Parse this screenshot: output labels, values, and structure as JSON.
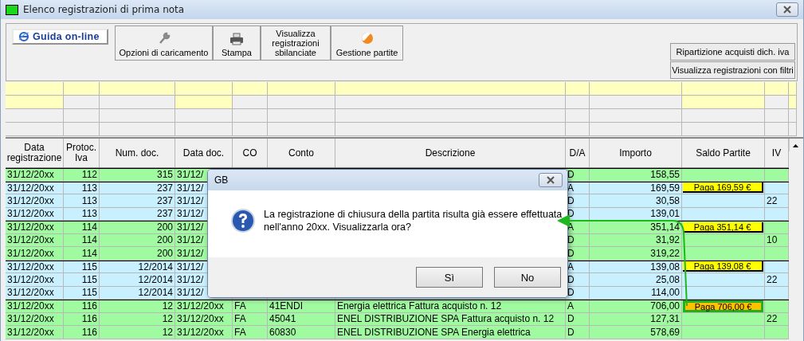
{
  "window": {
    "title": "Elenco registrazioni di prima nota"
  },
  "toolbar": {
    "help_button": "Guida on-line",
    "buttons": [
      {
        "label": "Opzioni di caricamento",
        "kind": "wrench"
      },
      {
        "label": "Stampa",
        "kind": "printer"
      },
      {
        "label": "Visualizza registrazioni sbilanciate",
        "kind": "plain"
      },
      {
        "label": "Gestione partite",
        "kind": "ball"
      }
    ],
    "side_buttons": [
      "Ripartizione acquisti dich. iva",
      "Visualizza registrazioni con filtri"
    ]
  },
  "table": {
    "columns": [
      "Data registrazione",
      "Protoc. Iva",
      "Num. doc.",
      "Data doc.",
      "CO",
      "Conto",
      "Descrizione",
      "D/A",
      "Importo",
      "Saldo Partite",
      "IV"
    ],
    "rows": [
      {
        "color": "#a0faa0",
        "group_start": true,
        "data_registrazione": "31/12/20xx",
        "protoc_iva": "112",
        "num_doc": "315",
        "data_doc": "31/12/",
        "da": "D",
        "importo": "158,55"
      },
      {
        "color": "#c8f0ff",
        "group_start": true,
        "data_registrazione": "31/12/20xx",
        "protoc_iva": "113",
        "num_doc": "237",
        "data_doc": "31/12/",
        "da": "A",
        "importo": "169,59",
        "saldo": {
          "label": "Paga 169,59 €",
          "selected": false
        }
      },
      {
        "color": "#c8f0ff",
        "group_start": false,
        "data_registrazione": "31/12/20xx",
        "protoc_iva": "113",
        "num_doc": "237",
        "data_doc": "31/12/",
        "da": "D",
        "importo": "30,58",
        "iv": "22"
      },
      {
        "color": "#c8f0ff",
        "group_start": false,
        "data_registrazione": "31/12/20xx",
        "protoc_iva": "113",
        "num_doc": "237",
        "data_doc": "31/12/",
        "da": "D",
        "importo": "139,01"
      },
      {
        "color": "#a0faa0",
        "group_start": true,
        "data_registrazione": "31/12/20xx",
        "protoc_iva": "114",
        "num_doc": "200",
        "data_doc": "31/12/",
        "da": "A",
        "importo": "351,14",
        "saldo": {
          "label": "Paga 351,14 €",
          "selected": false
        }
      },
      {
        "color": "#a0faa0",
        "group_start": false,
        "data_registrazione": "31/12/20xx",
        "protoc_iva": "114",
        "num_doc": "200",
        "data_doc": "31/12/",
        "da": "D",
        "importo": "31,92",
        "iv": "10"
      },
      {
        "color": "#a0faa0",
        "group_start": false,
        "data_registrazione": "31/12/20xx",
        "protoc_iva": "114",
        "num_doc": "200",
        "data_doc": "31/12/",
        "da": "D",
        "importo": "319,22"
      },
      {
        "color": "#c8f0ff",
        "group_start": true,
        "data_registrazione": "31/12/20xx",
        "protoc_iva": "115",
        "num_doc": "12/2014",
        "data_doc": "31/12/",
        "da": "A",
        "importo": "139,08",
        "saldo": {
          "label": "Paga 139,08 €",
          "selected": false
        }
      },
      {
        "color": "#c8f0ff",
        "group_start": false,
        "data_registrazione": "31/12/20xx",
        "protoc_iva": "115",
        "num_doc": "12/2014",
        "data_doc": "31/12/",
        "da": "D",
        "importo": "25,08",
        "iv": "22"
      },
      {
        "color": "#c8f0ff",
        "group_start": false,
        "data_registrazione": "31/12/20xx",
        "protoc_iva": "115",
        "num_doc": "12/2014",
        "data_doc": "31/12/",
        "da": "D",
        "importo": "114,00"
      },
      {
        "color": "#a0faa0",
        "group_start": true,
        "data_registrazione": "31/12/20xx",
        "protoc_iva": "116",
        "num_doc": "12",
        "data_doc": "31/12/20xx",
        "co": "FA",
        "conto": "41ENDI",
        "descrizione": "Energia elettrica Fattura acquisto n. 12",
        "da": "A",
        "importo": "706,00",
        "saldo": {
          "label": "Paga 706,00 €",
          "selected": true
        }
      },
      {
        "color": "#a0faa0",
        "group_start": false,
        "data_registrazione": "31/12/20xx",
        "protoc_iva": "116",
        "num_doc": "12",
        "data_doc": "31/12/20xx",
        "co": "FA",
        "conto": "45041",
        "descrizione": "ENEL DISTRIBUZIONE SPA Fattura acquisto n. 12",
        "da": "D",
        "importo": "127,31",
        "iv": "22"
      },
      {
        "color": "#a0faa0",
        "group_start": false,
        "data_registrazione": "31/12/20xx",
        "protoc_iva": "116",
        "num_doc": "12",
        "data_doc": "31/12/20xx",
        "co": "FA",
        "conto": "60830",
        "descrizione": "ENEL DISTRIBUZIONE SPA Energia elettrica",
        "da": "D",
        "importo": "578,69"
      }
    ]
  },
  "dialog": {
    "title": "GB",
    "message": "La registrazione di chiusura della partita risulta già essere effettuata nell'anno 20xx. Visualizzarla ora?",
    "buttons": [
      "Sì",
      "No"
    ]
  }
}
